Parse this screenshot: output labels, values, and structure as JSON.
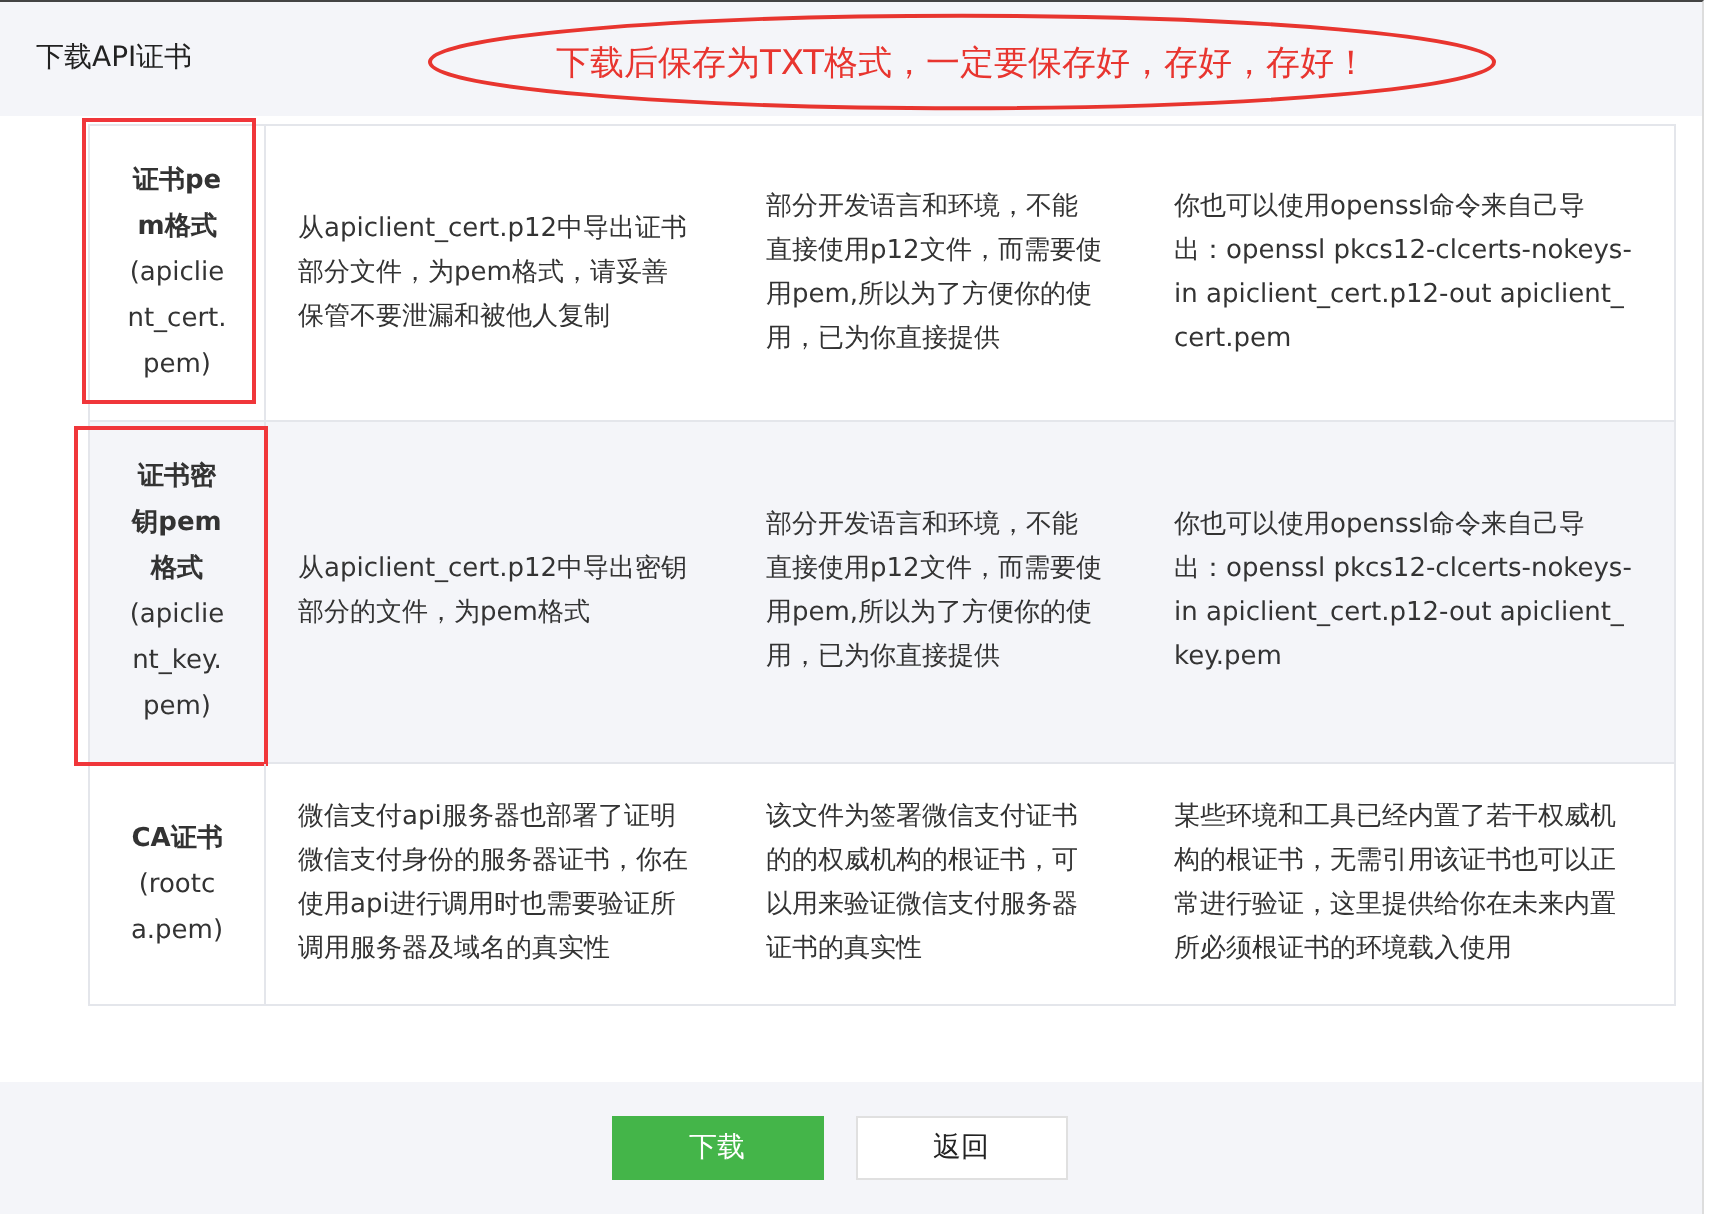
{
  "dialog": {
    "title": "下载API证书"
  },
  "annotation": {
    "text": "下载后保存为TXT格式，一定要保存好，存好，存好！"
  },
  "table": {
    "rows": [
      {
        "name": "证书pem格式",
        "file": "(apiclient_cert.pem)",
        "description": "从apiclient_cert.p12中导出证书部分文件，为pem格式，请妥善保管不要泄漏和被他人复制",
        "purpose": "部分开发语言和环境，不能直接使用p12文件，而需要使用pem,所以为了方便你的使用，已为你直接提供",
        "note": "你也可以使用openssl命令来自己导出：openssl pkcs12-clcerts-nokeys-in apiclient_cert.p12-out apiclient_cert.pem",
        "highlighted": true,
        "hovered": false
      },
      {
        "name": "证书密钥pem格式",
        "file": "(apiclient_key.pem)",
        "description": "从apiclient_cert.p12中导出密钥部分的文件，为pem格式",
        "purpose": "部分开发语言和环境，不能直接使用p12文件，而需要使用pem,所以为了方便你的使用，已为你直接提供",
        "note": "你也可以使用openssl命令来自己导出：openssl pkcs12-clcerts-nokeys-in apiclient_cert.p12-out apiclient_key.pem",
        "highlighted": true,
        "hovered": true
      },
      {
        "name": "CA证书",
        "file": "(rootca.pem)",
        "description": "微信支付api服务器也部署了证明微信支付身份的服务器证书，你在使用api进行调用时也需要验证所调用服务器及域名的真实性",
        "purpose": "该文件为签署微信支付证书的的权威机构的根证书，可以用来验证微信支付服务器证书的真实性",
        "note": "某些环境和工具已经内置了若干权威机构的根证书，无需引用该证书也可以正常进行验证，这里提供给你在未来内置所必须根证书的环境载入使用",
        "highlighted": false,
        "hovered": false
      }
    ]
  },
  "buttons": [
    {
      "label": "下载",
      "kind": "primary"
    },
    {
      "label": "返回",
      "kind": "secondary"
    }
  ]
}
